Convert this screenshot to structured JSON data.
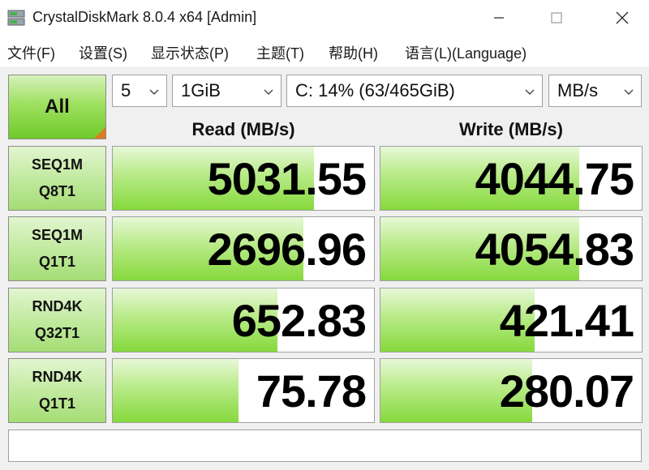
{
  "window": {
    "title": "CrystalDiskMark 8.0.4 x64 [Admin]"
  },
  "menu": [
    "文件(F)",
    "设置(S)",
    "显示状态(P)",
    "主题(T)",
    "帮助(H)",
    "语言(L)(Language)"
  ],
  "controls": {
    "all_label": "All",
    "count": "5",
    "size": "1GiB",
    "drive": "C: 14% (63/465GiB)",
    "unit": "MB/s"
  },
  "headers": {
    "read": "Read (MB/s)",
    "write": "Write (MB/s)"
  },
  "tests": [
    {
      "line1": "SEQ1M",
      "line2": "Q8T1",
      "read": "5031.55",
      "write": "4044.75",
      "read_fill": 0.77,
      "write_fill": 0.76
    },
    {
      "line1": "SEQ1M",
      "line2": "Q1T1",
      "read": "2696.96",
      "write": "4054.83",
      "read_fill": 0.73,
      "write_fill": 0.76
    },
    {
      "line1": "RND4K",
      "line2": "Q32T1",
      "read": "652.83",
      "write": "421.41",
      "read_fill": 0.63,
      "write_fill": 0.59
    },
    {
      "line1": "RND4K",
      "line2": "Q1T1",
      "read": "75.78",
      "write": "280.07",
      "read_fill": 0.48,
      "write_fill": 0.58
    }
  ],
  "comment": ""
}
